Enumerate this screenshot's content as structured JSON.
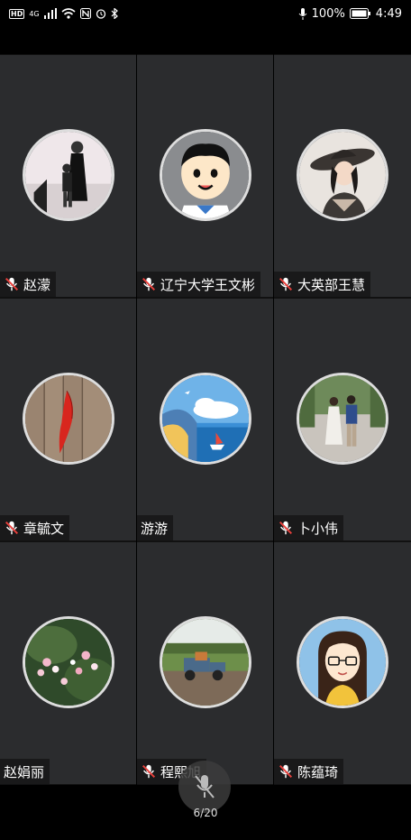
{
  "status_bar": {
    "hd": "HD",
    "network": "4G",
    "battery": "100%",
    "time": "4:49"
  },
  "participants": [
    {
      "name": "赵濛",
      "muted": true,
      "avatar": "woman-child-photo"
    },
    {
      "name": "辽宁大学王文彬",
      "muted": true,
      "avatar": "cartoon-boy"
    },
    {
      "name": "大英部王慧",
      "muted": true,
      "avatar": "woman-hat-photo"
    },
    {
      "name": "章毓文",
      "muted": true,
      "avatar": "red-leaf-wood"
    },
    {
      "name": "游游",
      "muted": false,
      "avatar": "sky-boat-illustration"
    },
    {
      "name": "卜小伟",
      "muted": true,
      "avatar": "couple-walking-photo"
    },
    {
      "name": "赵娟丽",
      "muted": false,
      "avatar": "pink-flowers"
    },
    {
      "name": "程熙旭",
      "muted": true,
      "avatar": "toy-truck-grass"
    },
    {
      "name": "陈蕴琦",
      "muted": true,
      "avatar": "cartoon-girl-glasses"
    }
  ],
  "page_indicator": "6/20",
  "colors": {
    "tile_bg": "#2b2c2e",
    "mute_red": "#e8403c"
  }
}
